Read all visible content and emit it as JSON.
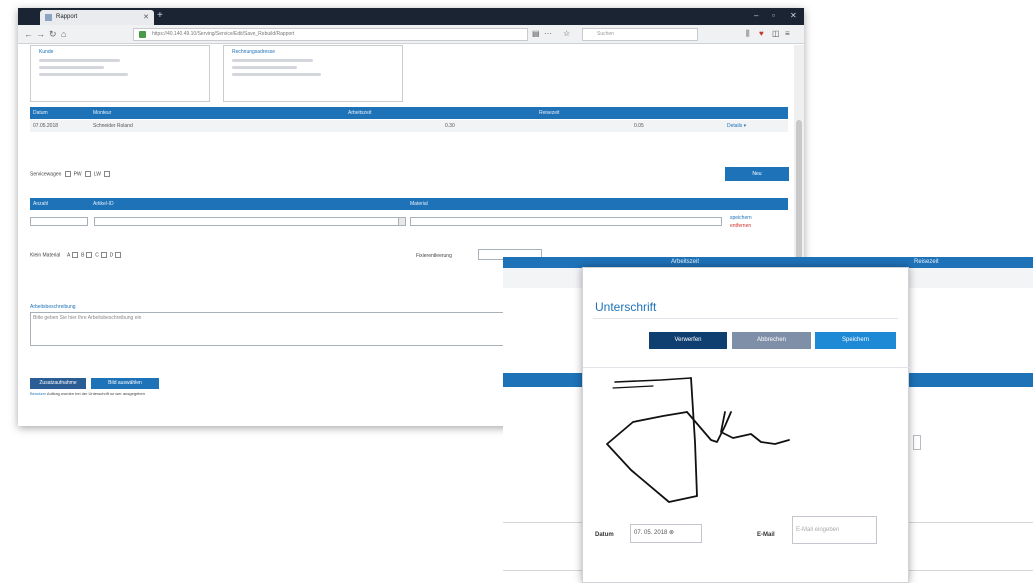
{
  "browser": {
    "tab_title": "Rapport",
    "url": "https://40.140.49.10/Serving/Service/Edit/Save_Rebuild/Rapport",
    "search_placeholder": "Suchen"
  },
  "page": {
    "customer_box_title": "Kunde",
    "billing_box_title": "Rechnungsadresse",
    "table1": {
      "headers": [
        "Datum",
        "Monteur",
        "Arbeitszeit",
        "Reisezeit"
      ],
      "row": {
        "date": "07.05.2018",
        "technician": "Schneider Roland",
        "work_time": "0.30",
        "travel_time": "0.05",
        "action": "Details ▾"
      }
    },
    "vehicle": {
      "label": "Servicewagen",
      "opt1": "PW",
      "opt2": "LW"
    },
    "new_button": "Neu",
    "table2": {
      "headers": [
        "Anzahl",
        "Artikel-ID",
        "Material"
      ]
    },
    "row_actions": {
      "save": "speichern",
      "delete": "entfernen"
    },
    "small_material": {
      "label": "Klein Material",
      "options": [
        "A",
        "B",
        "C",
        "D"
      ]
    },
    "dirt_label": "Fixierentleerung",
    "work_desc": {
      "title": "Arbeitsbeschreibung",
      "placeholder": "Bitte geben Sie hier Ihre Arbeitsbeschreibung ein"
    },
    "buttons": {
      "record": "Zusatzaufnahme",
      "select": "Bild auswählen"
    },
    "footer": {
      "link": "Benutzer",
      "text": "Auftrag wurden bei der Unterschrift so wer ausgegeben"
    }
  },
  "dialog_bg": {
    "col_work": "Arbeitszeit",
    "col_travel": "Reisezeit"
  },
  "modal": {
    "title": "Unterschrift",
    "discard": "Verwerfen",
    "cancel": "Abbrechen",
    "save": "Speichern",
    "date_label": "Datum",
    "date_value": "07. 05. 2018",
    "email_label": "E-Mail",
    "email_placeholder": "E-Mail eingeben"
  },
  "colors": {
    "accent": "#1e72b8",
    "dark": "#0f3f70",
    "titlebar": "#1b2433"
  }
}
